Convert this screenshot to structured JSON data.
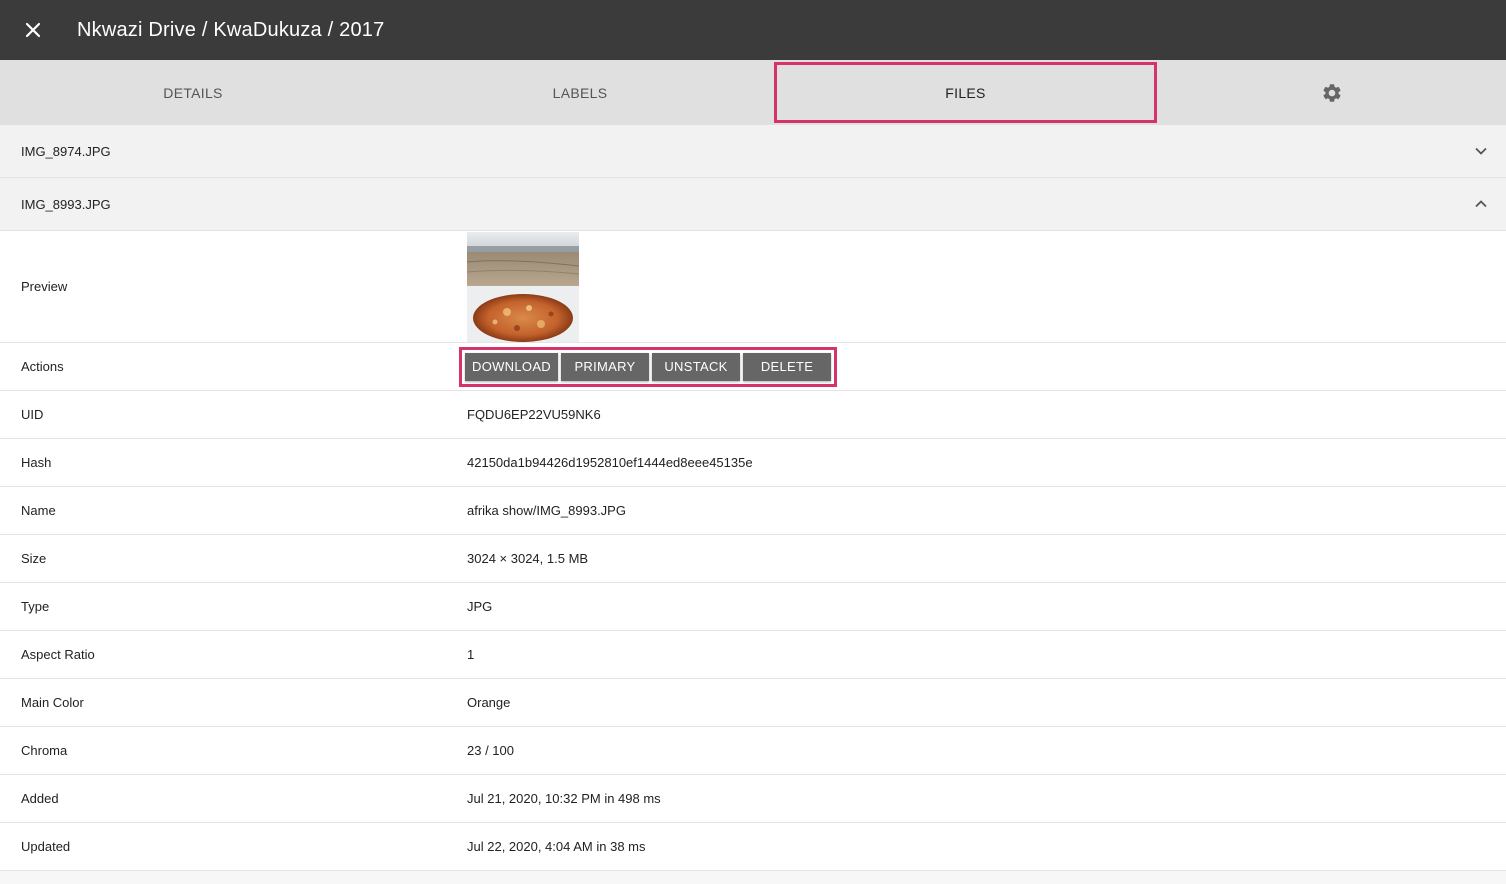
{
  "header": {
    "title": "Nkwazi Drive / KwaDukuza / 2017",
    "close_icon": "close-icon"
  },
  "tabs": [
    {
      "label": "DETAILS"
    },
    {
      "label": "LABELS"
    },
    {
      "label": "FILES",
      "active": true
    },
    {
      "label": "",
      "icon": "gear-icon"
    }
  ],
  "files": [
    {
      "name": "IMG_8974.JPG",
      "expanded": false,
      "icon": "chevron-down-icon"
    },
    {
      "name": "IMG_8993.JPG",
      "expanded": true,
      "icon": "chevron-up-icon"
    }
  ],
  "details": {
    "preview_label": "Preview",
    "actions_label": "Actions",
    "actions": {
      "download": "DOWNLOAD",
      "primary": "PRIMARY",
      "unstack": "UNSTACK",
      "delete": "DELETE"
    },
    "rows": [
      {
        "label": "UID",
        "value": "FQDU6EP22VU59NK6"
      },
      {
        "label": "Hash",
        "value": "42150da1b94426d1952810ef1444ed8eee45135e"
      },
      {
        "label": "Name",
        "value": "afrika show/IMG_8993.JPG"
      },
      {
        "label": "Size",
        "value": "3024 × 3024, 1.5 MB"
      },
      {
        "label": "Type",
        "value": "JPG"
      },
      {
        "label": "Aspect Ratio",
        "value": "1"
      },
      {
        "label": "Main Color",
        "value": "Orange"
      },
      {
        "label": "Chroma",
        "value": "23 / 100"
      },
      {
        "label": "Added",
        "value": "Jul 21, 2020, 10:32 PM in 498 ms"
      },
      {
        "label": "Updated",
        "value": "Jul 22, 2020, 4:04 AM in 38 ms"
      }
    ]
  },
  "colors": {
    "topbar": "#3b3b3b",
    "tabs_bg": "#e0e0e0",
    "highlight": "#d6336c",
    "button": "#666666"
  }
}
